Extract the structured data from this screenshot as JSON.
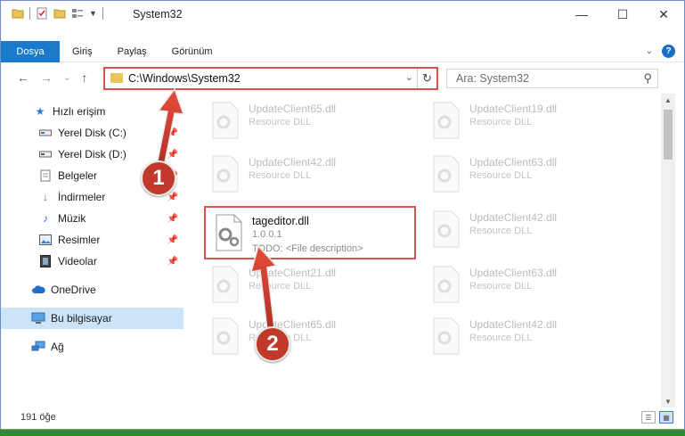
{
  "window": {
    "title": "System32"
  },
  "window_buttons": {
    "minimize": "—",
    "maximize": "☐",
    "close": "✕"
  },
  "ribbon": {
    "tabs": [
      {
        "label": "Dosya",
        "active": true
      },
      {
        "label": "Giriş"
      },
      {
        "label": "Paylaş"
      },
      {
        "label": "Görünüm"
      }
    ]
  },
  "nav": {
    "back": "←",
    "forward": "→",
    "recent": "⌄",
    "up": "↑",
    "address": "C:\\Windows\\System32",
    "search_placeholder": "Ara: System32"
  },
  "sidebar": {
    "items": [
      {
        "label": "Hızlı erişim",
        "icon": "star-icon"
      },
      {
        "label": "Yerel Disk (C:)",
        "icon": "drive-icon",
        "pinned": true
      },
      {
        "label": "Yerel Disk (D:)",
        "icon": "drive-icon",
        "pinned": true
      },
      {
        "label": "Belgeler",
        "icon": "documents-icon",
        "pinned": true
      },
      {
        "label": "İndirmeler",
        "icon": "download-icon",
        "pinned": true
      },
      {
        "label": "Müzik",
        "icon": "music-icon",
        "pinned": true
      },
      {
        "label": "Resimler",
        "icon": "pictures-icon",
        "pinned": true
      },
      {
        "label": "Videolar",
        "icon": "video-icon",
        "pinned": true
      },
      {
        "label": "OneDrive",
        "icon": "cloud-icon"
      },
      {
        "label": "Bu bilgisayar",
        "icon": "computer-icon",
        "selected": true
      },
      {
        "label": "Ağ",
        "icon": "network-icon"
      }
    ]
  },
  "files": {
    "left": [
      {
        "name": "UpdateClient65.dll",
        "desc": "Resource DLL"
      },
      {
        "name": "UpdateClient42.dll",
        "desc": "Resource DLL"
      },
      {
        "name": "tageditor.dll",
        "desc": "1.0.0.1",
        "desc2": "TODO: <File description>",
        "focus": true
      },
      {
        "name": "UpdateClient21.dll",
        "desc": "Resource DLL"
      },
      {
        "name": "UpdateClient65.dll",
        "desc": "Resource DLL"
      }
    ],
    "right": [
      {
        "name": "UpdateClient19.dll",
        "desc": "Resource DLL"
      },
      {
        "name": "UpdateClient63.dll",
        "desc": "Resource DLL"
      },
      {
        "name": "UpdateClient42.dll",
        "desc": "Resource DLL"
      },
      {
        "name": "UpdateClient63.dll",
        "desc": "Resource DLL"
      },
      {
        "name": "UpdateClient42.dll",
        "desc": "Resource DLL"
      }
    ]
  },
  "status": {
    "count": "191 öğe"
  },
  "callouts": {
    "one": "1",
    "two": "2"
  },
  "colors": {
    "accent": "#1979ca",
    "highlight": "#d9534f",
    "callout": "#c0392b"
  }
}
